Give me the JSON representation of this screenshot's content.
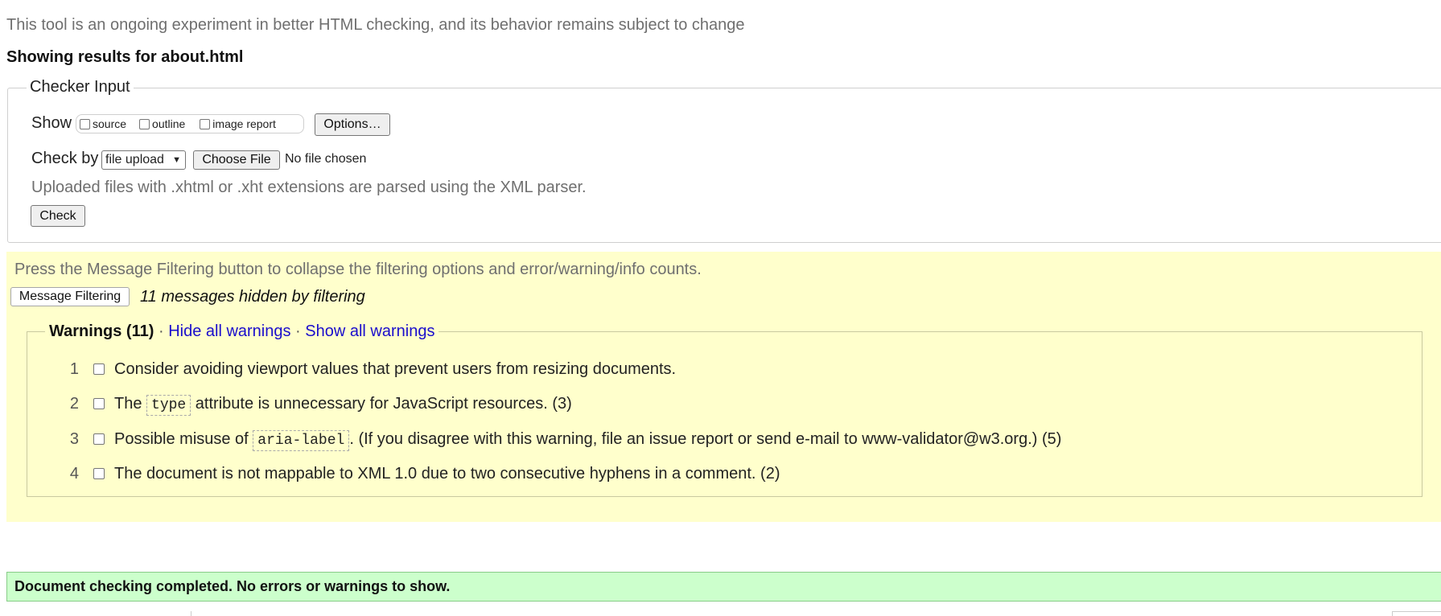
{
  "disclaimer": "This tool is an ongoing experiment in better HTML checking, and its behavior remains subject to change",
  "results_title": "Showing results for about.html",
  "checker": {
    "legend": "Checker Input",
    "show_label": "Show",
    "show_options": [
      {
        "label": "source",
        "checked": false
      },
      {
        "label": "outline",
        "checked": false
      },
      {
        "label": "image report",
        "checked": false
      }
    ],
    "options_button": "Options…",
    "check_by_label": "Check by",
    "check_by_value": "file upload",
    "choose_file_button": "Choose File",
    "no_file_text": "No file chosen",
    "upload_note": "Uploaded files with .xhtml or .xht extensions are parsed using the XML parser.",
    "check_button": "Check"
  },
  "filtering": {
    "hint": "Press the Message Filtering button to collapse the filtering options and error/warning/info counts.",
    "button": "Message Filtering",
    "hidden_count": "11 messages hidden by filtering"
  },
  "warnings": {
    "title": "Warnings (11)",
    "separator": "·",
    "hide_all": "Hide all warnings",
    "show_all": "Show all warnings",
    "items": [
      {
        "num": "1",
        "before": "Consider avoiding viewport values that prevent users from resizing documents.",
        "code": "",
        "after": ""
      },
      {
        "num": "2",
        "before": "The ",
        "code": "type",
        "after": " attribute is unnecessary for JavaScript resources. (3)"
      },
      {
        "num": "3",
        "before": "Possible misuse of ",
        "code": "aria-label",
        "after": ". (If you disagree with this warning, file an issue report or send e-mail to www-validator@w3.org.) (5)"
      },
      {
        "num": "4",
        "before": "The document is not mappable to XML 1.0 due to two consecutive hyphens in a comment. (2)",
        "code": "",
        "after": ""
      }
    ]
  },
  "success_message": "Document checking completed. No errors or warnings to show.",
  "colors": {
    "filter_panel": "#ffffcc",
    "success_panel": "#ccffcc",
    "link": "#1a0dcc"
  }
}
